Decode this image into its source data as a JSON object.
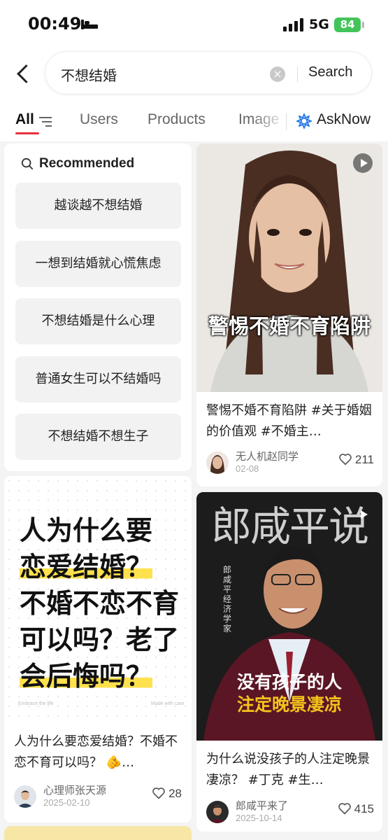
{
  "status_bar": {
    "time": "00:49",
    "network": "5G",
    "battery": "84"
  },
  "search": {
    "query": "不想结婚",
    "button_label": "Search"
  },
  "tabs": [
    {
      "label": "All"
    },
    {
      "label": "Users"
    },
    {
      "label": "Products"
    },
    {
      "label": "Image"
    },
    {
      "label": "AskNow"
    }
  ],
  "recommended": {
    "title": "Recommended",
    "items": [
      "越谈越不想结婚",
      "一想到结婚就心慌焦虑",
      "不想结婚是什么心理",
      "普通女生可以不结婚吗",
      "不想结婚不想生子"
    ]
  },
  "posts": [
    {
      "cover_text": "警惕不婚不育陷阱",
      "description": "警惕不婚不育陷阱 #关于婚姻的价值观 #不婚主…",
      "author": "无人机赵同学",
      "date": "02-08",
      "likes": "211"
    },
    {
      "cover_lines": [
        "人为什么要",
        "恋爱结婚？",
        "不婚不恋不育",
        "可以吗？老了",
        "会后悔吗？"
      ],
      "cover_footer_left": "Embrace the life",
      "cover_footer_right": "Made with care",
      "description": "人为什么要恋爱结婚？不婚不恋不育可以吗？ 🫵…",
      "author": "心理师张天源",
      "date": "2025-02-10",
      "likes": "28"
    },
    {
      "cover_title": "郎咸平说",
      "cover_vertical": "郎咸平 经济学家",
      "cover_line1": "没有孩子的人",
      "cover_line2": "注定晚景凄凉",
      "description": "为什么说没孩子的人注定晚景凄凉？ #丁克 #生…",
      "author": "郎咸平来了",
      "date": "2025-10-14",
      "likes": "415"
    }
  ]
}
